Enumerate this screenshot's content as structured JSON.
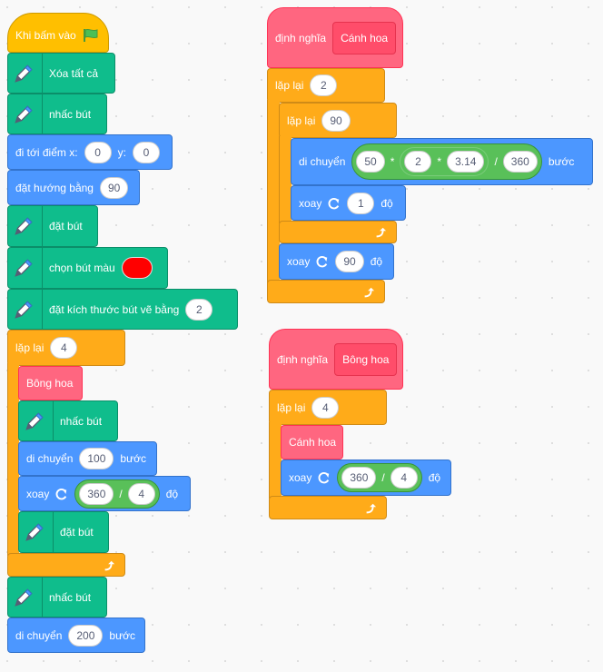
{
  "main_script": {
    "hat": "Khi bấm vào",
    "flag_icon": "green-flag-icon",
    "clear": "Xóa tất cả",
    "pen_up": "nhấc bút",
    "goto": {
      "label": "đi tới điểm x:",
      "x": "0",
      "ylabel": "y:",
      "y": "0"
    },
    "point": {
      "label": "đặt hướng bằng",
      "value": "90"
    },
    "pen_down": "đặt bút",
    "color": {
      "label": "chọn bút màu",
      "value": "#ff0000"
    },
    "size": {
      "label": "đặt kích thước bút vẽ bằng",
      "value": "2"
    },
    "repeat": {
      "label": "lặp lại",
      "value": "4",
      "call": "Bông hoa",
      "pen_up": "nhấc bút",
      "move": {
        "label": "di chuyển",
        "value": "100",
        "unit": "bước"
      },
      "turn": {
        "label": "xoay",
        "a": "360",
        "op": "/",
        "b": "4",
        "unit": "độ"
      },
      "pen_down": "đặt bút"
    },
    "pen_up2": "nhấc bút",
    "move2": {
      "label": "di chuyển",
      "value": "200",
      "unit": "bước"
    }
  },
  "petal_def": {
    "define": "định nghĩa",
    "name": "Cánh hoa",
    "repeat": {
      "label": "lặp lại",
      "value": "2",
      "inner": {
        "label": "lặp lại",
        "value": "90",
        "move": {
          "label": "di chuyển",
          "a": "50",
          "op1": "*",
          "b": "2",
          "op2": "*",
          "c": "3.14",
          "op3": "/",
          "d": "360",
          "unit": "bước"
        },
        "turn": {
          "label": "xoay",
          "value": "1",
          "unit": "độ"
        }
      },
      "turn": {
        "label": "xoay",
        "value": "90",
        "unit": "độ"
      }
    }
  },
  "flower_def": {
    "define": "định nghĩa",
    "name": "Bông hoa",
    "repeat": {
      "label": "lặp lại",
      "value": "4",
      "call": "Cánh hoa",
      "turn": {
        "label": "xoay",
        "a": "360",
        "op": "/",
        "b": "4",
        "unit": "độ"
      }
    }
  },
  "colors": {
    "events": "#ffbf00",
    "pen": "#0fbd8c",
    "motion": "#4c97ff",
    "control": "#ffab19",
    "custom": "#ff6680",
    "operators": "#59c059"
  }
}
